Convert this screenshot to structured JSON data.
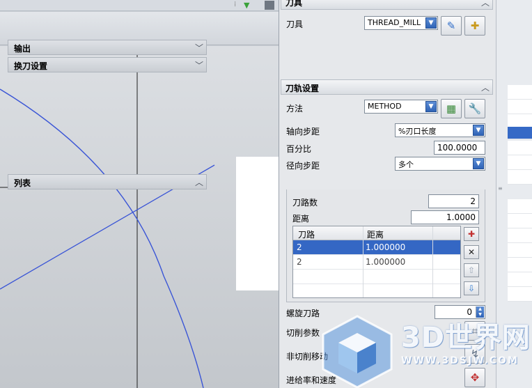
{
  "dialog": {
    "tool_section": {
      "title": "刀具",
      "tool_label": "刀具",
      "tool_value": "THREAD_MILL",
      "output_label": "输出",
      "tool_change_label": "换刀设置"
    },
    "path_section": {
      "title": "刀轨设置",
      "method_label": "方法",
      "method_value": "METHOD",
      "axial_step_label": "轴向步距",
      "axial_step_value": "%刃口长度",
      "percent_label": "百分比",
      "percent_value": "100.0000",
      "radial_step_label": "径向步距",
      "radial_step_value": "多个",
      "list": {
        "title": "列表",
        "passes_label": "刀路数",
        "passes_value": "2",
        "distance_label": "距离",
        "distance_value": "1.0000",
        "columns": [
          "刀路",
          "距离"
        ],
        "rows": [
          {
            "pass": "2",
            "distance": "1.000000"
          },
          {
            "pass": "2",
            "distance": "1.000000"
          }
        ]
      },
      "spiral_label": "螺旋刀路",
      "spiral_value": "0",
      "cut_params_label": "切削参数",
      "non_cut_label": "非切削移动",
      "feed_label": "进给率和速度"
    }
  },
  "watermark": {
    "brand": "3D世界网",
    "url": "WWW.3DSJW.COM"
  },
  "colors": {
    "selection": "#3467c4",
    "curve": "#3a55d6",
    "dialog_bg": "#e6e8eb"
  },
  "icons": [
    "tool-edit-icon",
    "tool-new-icon",
    "method-edit-icon",
    "wrench-icon",
    "add-row-icon",
    "delete-row-icon",
    "move-up-icon",
    "move-down-icon",
    "cut-params-icon",
    "non-cut-icon",
    "feed-speed-icon",
    "chevron-up-icon",
    "chevron-down-icon"
  ]
}
